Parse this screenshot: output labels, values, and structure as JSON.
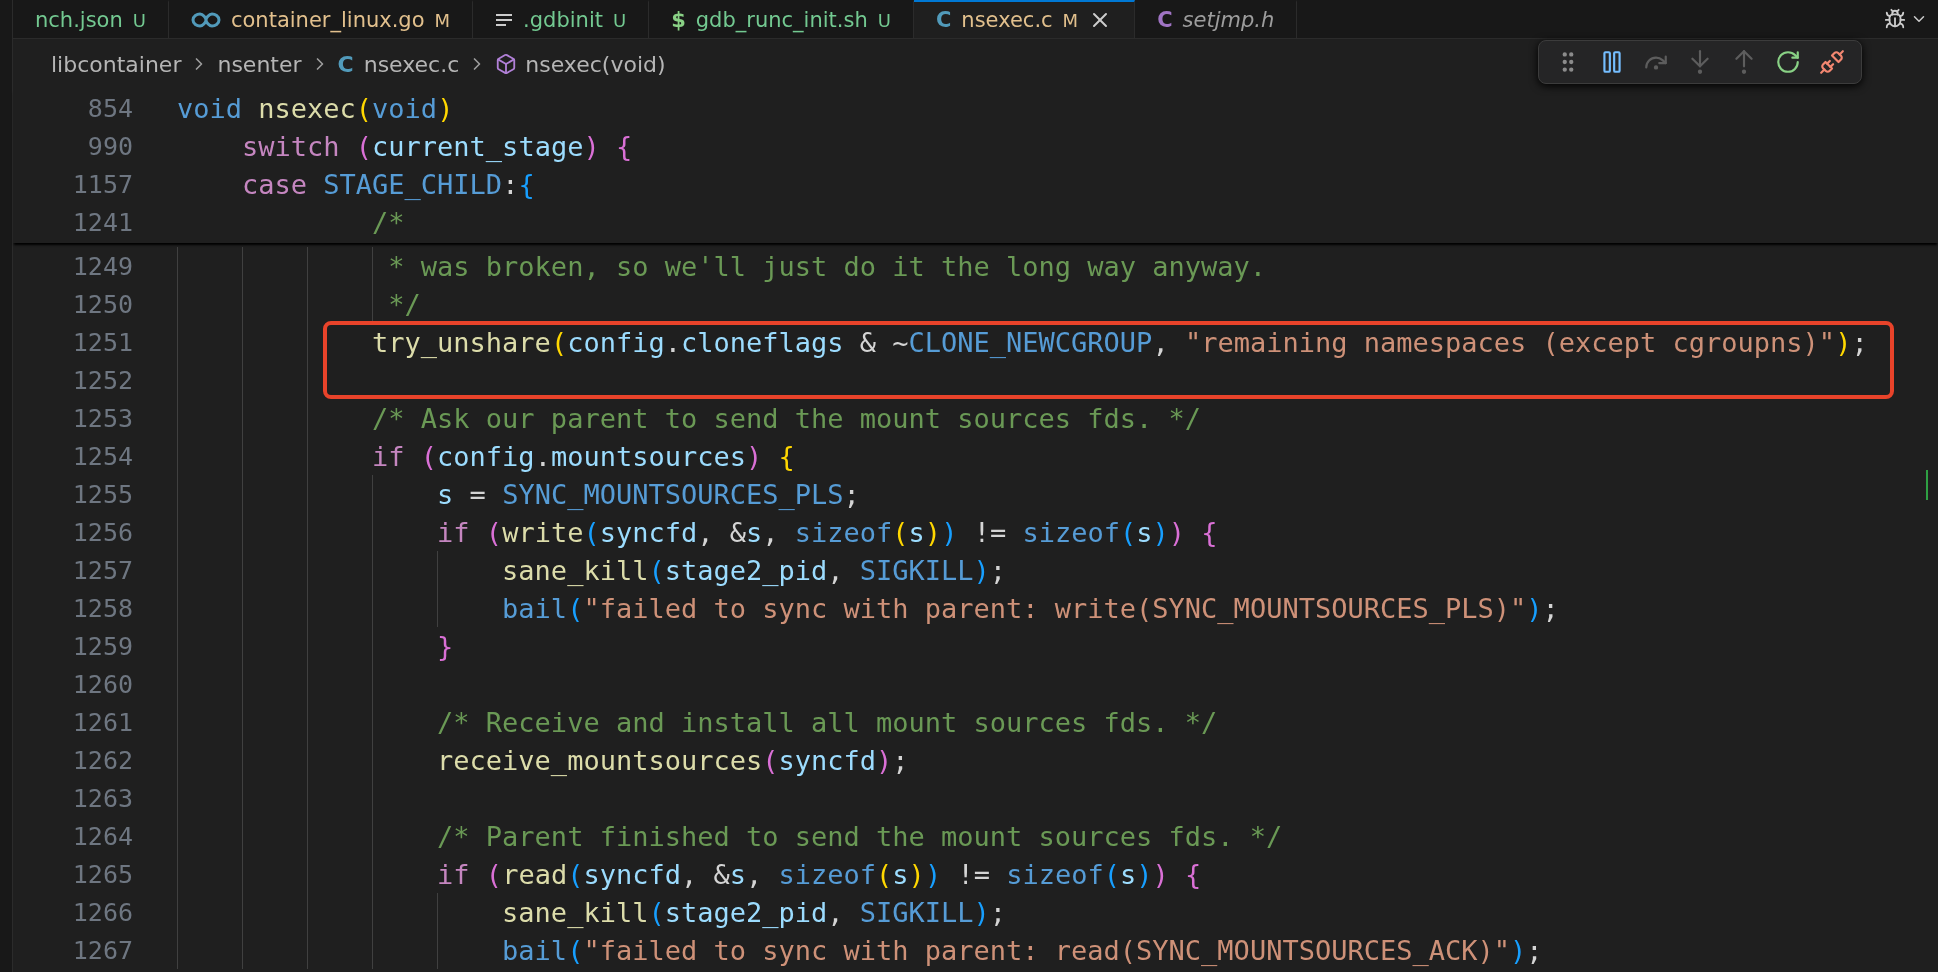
{
  "tabs": [
    {
      "label": "nch.json",
      "status": "U",
      "kind": "none",
      "selected": false,
      "preview": false
    },
    {
      "label": "container_linux.go",
      "status": "M",
      "kind": "go",
      "selected": false,
      "preview": false
    },
    {
      "label": ".gdbinit",
      "status": "U",
      "kind": "lines",
      "selected": false,
      "preview": false
    },
    {
      "label": "gdb_runc_init.sh",
      "status": "U",
      "kind": "glyph",
      "icon": "$",
      "color": "#89d185",
      "selected": false,
      "preview": false
    },
    {
      "label": "nsexec.c",
      "status": "M",
      "kind": "glyph",
      "icon": "C",
      "color": "#519aba",
      "selected": true,
      "preview": false
    },
    {
      "label": "setjmp.h",
      "kind": "glyph",
      "icon": "C",
      "color": "#a074c4",
      "selected": false,
      "preview": true
    }
  ],
  "breadcrumb": [
    {
      "label": "libcontainer",
      "kind": "folder"
    },
    {
      "label": "nsenter",
      "kind": "folder"
    },
    {
      "label": "nsexec.c",
      "kind": "file",
      "icon": "C"
    },
    {
      "label": "nsexec(void)",
      "kind": "symbol"
    }
  ],
  "debug_toolbar": [
    {
      "kind": "grip",
      "disabled": false
    },
    {
      "kind": "pause",
      "disabled": false
    },
    {
      "kind": "step-over",
      "disabled": true
    },
    {
      "kind": "step-into",
      "disabled": true
    },
    {
      "kind": "step-out",
      "disabled": true
    },
    {
      "kind": "restart",
      "disabled": false
    },
    {
      "kind": "disconnect",
      "disabled": false
    }
  ],
  "sticky_lines": [
    {
      "number": "854",
      "tokens": [
        {
          "text": "void",
          "kind": "kw"
        },
        {
          "text": " nsexec",
          "kind": "fn"
        },
        {
          "text": "(",
          "kind": "b1"
        },
        {
          "text": "void",
          "kind": "kw"
        },
        {
          "text": ")",
          "kind": "b1"
        }
      ]
    },
    {
      "number": "990",
      "tokens": [
        {
          "text": "    switch",
          "kind": "ctl"
        },
        {
          "text": " (",
          "kind": "b2"
        },
        {
          "text": "current_stage",
          "kind": "var"
        },
        {
          "text": ")",
          "kind": "b2"
        },
        {
          "text": " {",
          "kind": "b2"
        }
      ]
    },
    {
      "number": "1157",
      "tokens": [
        {
          "text": "    case",
          "kind": "ctl"
        },
        {
          "text": " STAGE_CHILD",
          "kind": "mac"
        },
        {
          "text": ":",
          "kind": "p"
        },
        {
          "text": "{",
          "kind": "b3"
        }
      ]
    },
    {
      "number": "1241",
      "tokens": [
        {
          "text": "            /*",
          "kind": "com"
        }
      ]
    }
  ],
  "lines": [
    {
      "number": "1249",
      "boxed": false,
      "tokens": [
        {
          "text": "             * was broken, so we'll just do it the long way anyway.",
          "kind": "com"
        }
      ]
    },
    {
      "number": "1250",
      "boxed": false,
      "tokens": [
        {
          "text": "             */",
          "kind": "com"
        }
      ]
    },
    {
      "number": "1251",
      "boxed": true,
      "tokens": [
        {
          "text": "            try_unshare",
          "kind": "fn"
        },
        {
          "text": "(",
          "kind": "b1"
        },
        {
          "text": "config",
          "kind": "var"
        },
        {
          "text": ".",
          "kind": "p"
        },
        {
          "text": "cloneflags",
          "kind": "var"
        },
        {
          "text": " & ~",
          "kind": "p"
        },
        {
          "text": "CLONE_NEWCGROUP",
          "kind": "mac"
        },
        {
          "text": ", ",
          "kind": "p"
        },
        {
          "text": "\"remaining namespaces (except cgroupns)\"",
          "kind": "str"
        },
        {
          "text": ")",
          "kind": "b1"
        },
        {
          "text": ";",
          "kind": "p"
        }
      ]
    },
    {
      "number": "1252",
      "boxed": true
    },
    {
      "number": "1253",
      "boxed": false,
      "tokens": [
        {
          "text": "            /* Ask our parent to send the mount sources fds. */",
          "kind": "com"
        }
      ]
    },
    {
      "number": "1254",
      "boxed": false,
      "tokens": [
        {
          "text": "            if",
          "kind": "ctl"
        },
        {
          "text": " (",
          "kind": "b2"
        },
        {
          "text": "config",
          "kind": "var"
        },
        {
          "text": ".",
          "kind": "p"
        },
        {
          "text": "mountsources",
          "kind": "var"
        },
        {
          "text": ")",
          "kind": "b2"
        },
        {
          "text": " {",
          "kind": "b1"
        }
      ]
    },
    {
      "number": "1255",
      "boxed": false,
      "tokens": [
        {
          "text": "                s",
          "kind": "var"
        },
        {
          "text": " = ",
          "kind": "p"
        },
        {
          "text": "SYNC_MOUNTSOURCES_PLS",
          "kind": "mac"
        },
        {
          "text": ";",
          "kind": "p"
        }
      ]
    },
    {
      "number": "1256",
      "boxed": false,
      "tokens": [
        {
          "text": "                if",
          "kind": "ctl"
        },
        {
          "text": " (",
          "kind": "b2"
        },
        {
          "text": "write",
          "kind": "fn"
        },
        {
          "text": "(",
          "kind": "b3"
        },
        {
          "text": "syncfd",
          "kind": "var"
        },
        {
          "text": ", &",
          "kind": "p"
        },
        {
          "text": "s",
          "kind": "var"
        },
        {
          "text": ", ",
          "kind": "p"
        },
        {
          "text": "sizeof",
          "kind": "kw"
        },
        {
          "text": "(",
          "kind": "b1"
        },
        {
          "text": "s",
          "kind": "var"
        },
        {
          "text": ")",
          "kind": "b1"
        },
        {
          "text": ")",
          "kind": "b3"
        },
        {
          "text": " != ",
          "kind": "p"
        },
        {
          "text": "sizeof",
          "kind": "kw"
        },
        {
          "text": "(",
          "kind": "b3"
        },
        {
          "text": "s",
          "kind": "var"
        },
        {
          "text": ")",
          "kind": "b3"
        },
        {
          "text": ")",
          "kind": "b2"
        },
        {
          "text": " {",
          "kind": "b2"
        }
      ]
    },
    {
      "number": "1257",
      "boxed": false,
      "tokens": [
        {
          "text": "                    sane_kill",
          "kind": "fn"
        },
        {
          "text": "(",
          "kind": "b3"
        },
        {
          "text": "stage2_pid",
          "kind": "var"
        },
        {
          "text": ", ",
          "kind": "p"
        },
        {
          "text": "SIGKILL",
          "kind": "mac"
        },
        {
          "text": ")",
          "kind": "b3"
        },
        {
          "text": ";",
          "kind": "p"
        }
      ]
    },
    {
      "number": "1258",
      "boxed": false,
      "tokens": [
        {
          "text": "                    bail",
          "kind": "mac"
        },
        {
          "text": "(",
          "kind": "b3"
        },
        {
          "text": "\"failed to sync with parent: write(SYNC_MOUNTSOURCES_PLS)\"",
          "kind": "str"
        },
        {
          "text": ")",
          "kind": "b3"
        },
        {
          "text": ";",
          "kind": "p"
        }
      ]
    },
    {
      "number": "1259",
      "boxed": false,
      "tokens": [
        {
          "text": "                }",
          "kind": "b2"
        }
      ]
    },
    {
      "number": "1260",
      "boxed": false
    },
    {
      "number": "1261",
      "boxed": false,
      "tokens": [
        {
          "text": "                /* Receive and install all mount sources fds. */",
          "kind": "com"
        }
      ]
    },
    {
      "number": "1262",
      "boxed": false,
      "tokens": [
        {
          "text": "                receive_mountsources",
          "kind": "fn"
        },
        {
          "text": "(",
          "kind": "b2"
        },
        {
          "text": "syncfd",
          "kind": "var"
        },
        {
          "text": ")",
          "kind": "b2"
        },
        {
          "text": ";",
          "kind": "p"
        }
      ]
    },
    {
      "number": "1263",
      "boxed": false
    },
    {
      "number": "1264",
      "boxed": false,
      "tokens": [
        {
          "text": "                /* Parent finished to send the mount sources fds. */",
          "kind": "com"
        }
      ]
    },
    {
      "number": "1265",
      "boxed": false,
      "tokens": [
        {
          "text": "                if",
          "kind": "ctl"
        },
        {
          "text": " (",
          "kind": "b2"
        },
        {
          "text": "read",
          "kind": "fn"
        },
        {
          "text": "(",
          "kind": "b3"
        },
        {
          "text": "syncfd",
          "kind": "var"
        },
        {
          "text": ", &",
          "kind": "p"
        },
        {
          "text": "s",
          "kind": "var"
        },
        {
          "text": ", ",
          "kind": "p"
        },
        {
          "text": "sizeof",
          "kind": "kw"
        },
        {
          "text": "(",
          "kind": "b1"
        },
        {
          "text": "s",
          "kind": "var"
        },
        {
          "text": ")",
          "kind": "b1"
        },
        {
          "text": ")",
          "kind": "b3"
        },
        {
          "text": " != ",
          "kind": "p"
        },
        {
          "text": "sizeof",
          "kind": "kw"
        },
        {
          "text": "(",
          "kind": "b3"
        },
        {
          "text": "s",
          "kind": "var"
        },
        {
          "text": ")",
          "kind": "b3"
        },
        {
          "text": ")",
          "kind": "b2"
        },
        {
          "text": " {",
          "kind": "b2"
        }
      ]
    },
    {
      "number": "1266",
      "boxed": false,
      "tokens": [
        {
          "text": "                    sane_kill",
          "kind": "fn"
        },
        {
          "text": "(",
          "kind": "b3"
        },
        {
          "text": "stage2_pid",
          "kind": "var"
        },
        {
          "text": ", ",
          "kind": "p"
        },
        {
          "text": "SIGKILL",
          "kind": "mac"
        },
        {
          "text": ")",
          "kind": "b3"
        },
        {
          "text": ";",
          "kind": "p"
        }
      ]
    },
    {
      "number": "1267",
      "boxed": false,
      "tokens": [
        {
          "text": "                    bail",
          "kind": "mac"
        },
        {
          "text": "(",
          "kind": "b3"
        },
        {
          "text": "\"failed to sync with parent: read(SYNC_MOUNTSOURCES_ACK)\"",
          "kind": "str"
        },
        {
          "text": ")",
          "kind": "b3"
        },
        {
          "text": ";",
          "kind": "p"
        }
      ]
    }
  ]
}
